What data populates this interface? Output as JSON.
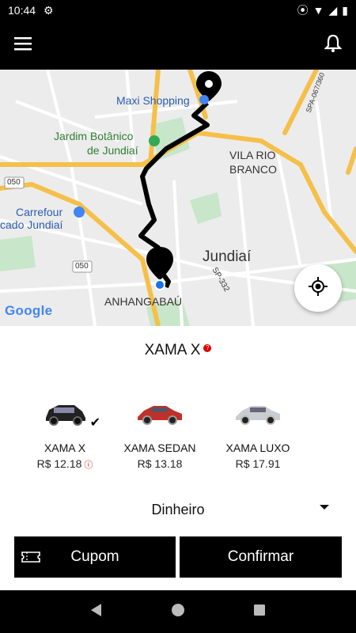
{
  "status_bar": {
    "time": "10:44"
  },
  "map": {
    "labels": {
      "maxi_shopping": "Maxi Shopping",
      "jardim_botanico_1": "Jardim Botânico",
      "jardim_botanico_2": "de Jundiaí",
      "vila_rio_1": "VILA RIO",
      "vila_rio_2": "BRANCO",
      "carrefour_1": "Carrefour",
      "carrefour_2": "cado Jundiaí",
      "jundiai": "Jundiaí",
      "anhangabau": "ANHANGABAÚ",
      "road_050_a": "050",
      "road_050_b": "050",
      "road_sp332": "SP-332",
      "road_sp067": "SPA-067/360"
    },
    "google": "Google"
  },
  "service": {
    "title": "XAMA X",
    "info_icon": "info-icon"
  },
  "options": [
    {
      "name": "XAMA X",
      "price": "R$ 12.18",
      "selected": true
    },
    {
      "name": "XAMA SEDAN",
      "price": "R$ 13.18",
      "selected": false
    },
    {
      "name": "XAMA LUXO",
      "price": "R$ 17.91",
      "selected": false
    }
  ],
  "payment": {
    "label": "Dinheiro"
  },
  "buttons": {
    "cupom": "Cupom",
    "confirm": "Confirmar"
  },
  "colors": {
    "accent": "#000000",
    "route": "#000000",
    "major_road": "#f5c04a",
    "park": "#c8e6c9",
    "water": "#aadaff"
  }
}
